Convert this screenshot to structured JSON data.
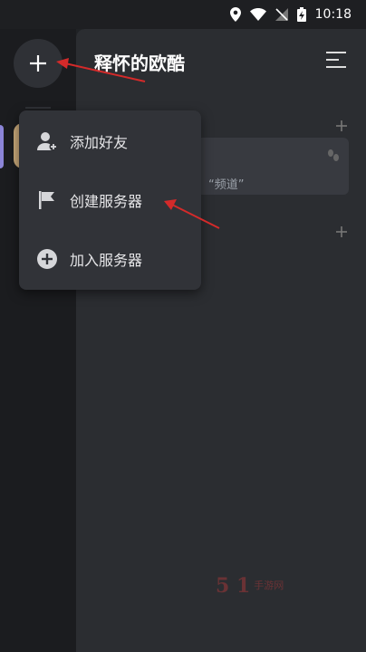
{
  "status_bar": {
    "time": "10:18"
  },
  "panel": {
    "title": "释怀的欧酷"
  },
  "channel": {
    "snippet": "“频道”"
  },
  "popup_menu": {
    "items": [
      {
        "label": "添加好友",
        "icon": "add-friend-icon"
      },
      {
        "label": "创建服务器",
        "icon": "flag-icon"
      },
      {
        "label": "加入服务器",
        "icon": "add-circle-icon"
      }
    ]
  },
  "watermark": {
    "number": "5  1",
    "brand": "手游网"
  },
  "colors": {
    "background": "#202225",
    "panel": "#2b2d31",
    "popup": "#313338",
    "arrow": "#d42a2a",
    "accent": "#8b84d7"
  }
}
